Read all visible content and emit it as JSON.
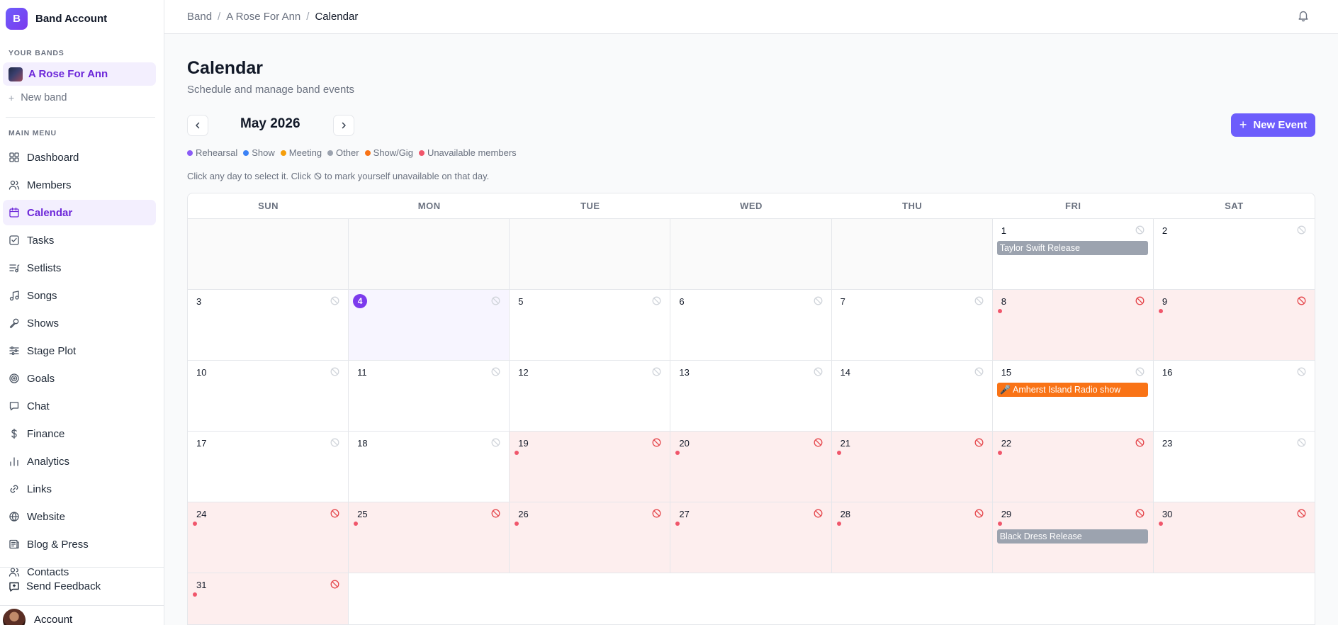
{
  "brand": {
    "initial": "B",
    "name": "Band Account"
  },
  "sidebar": {
    "bands_label": "YOUR BANDS",
    "current_band": "A Rose For Ann",
    "new_band": "New band",
    "menu_label": "MAIN MENU",
    "items": [
      {
        "label": "Dashboard",
        "icon": "dashboard-icon"
      },
      {
        "label": "Members",
        "icon": "users-icon"
      },
      {
        "label": "Calendar",
        "icon": "calendar-icon",
        "active": true
      },
      {
        "label": "Tasks",
        "icon": "checkbox-icon"
      },
      {
        "label": "Setlists",
        "icon": "list-music-icon"
      },
      {
        "label": "Songs",
        "icon": "music-note-icon"
      },
      {
        "label": "Shows",
        "icon": "microphone-icon"
      },
      {
        "label": "Stage Plot",
        "icon": "sliders-icon"
      },
      {
        "label": "Goals",
        "icon": "target-icon"
      },
      {
        "label": "Chat",
        "icon": "chat-icon"
      },
      {
        "label": "Finance",
        "icon": "dollar-icon"
      },
      {
        "label": "Analytics",
        "icon": "bar-chart-icon"
      },
      {
        "label": "Links",
        "icon": "link-icon"
      },
      {
        "label": "Website",
        "icon": "globe-icon"
      },
      {
        "label": "Blog & Press",
        "icon": "newspaper-icon"
      },
      {
        "label": "Contacts",
        "icon": "contacts-icon"
      }
    ],
    "feedback": "Send Feedback",
    "account": "Account"
  },
  "breadcrumb": [
    "Band",
    "A Rose For Ann",
    "Calendar"
  ],
  "page": {
    "title": "Calendar",
    "subtitle": "Schedule and manage band events",
    "month": "May 2026",
    "new_event": "New Event",
    "hint_before": "Click any day to select it. Click",
    "hint_after": "to mark yourself unavailable on that day."
  },
  "legend": [
    {
      "label": "Rehearsal",
      "color": "#8b5cf6"
    },
    {
      "label": "Show",
      "color": "#3b82f6"
    },
    {
      "label": "Meeting",
      "color": "#f59e0b"
    },
    {
      "label": "Other",
      "color": "#9ca3af"
    },
    {
      "label": "Show/Gig",
      "color": "#f97316"
    },
    {
      "label": "Unavailable members",
      "color": "#f0566b"
    }
  ],
  "weekdays": [
    "SUN",
    "MON",
    "TUE",
    "WED",
    "THU",
    "FRI",
    "SAT"
  ],
  "calendar": {
    "leading_empty": 5,
    "today": 4,
    "days": [
      {
        "d": "1",
        "events": [
          {
            "title": "Taylor Swift Release",
            "type": "other"
          }
        ]
      },
      {
        "d": "2"
      },
      {
        "d": "3"
      },
      {
        "d": "4"
      },
      {
        "d": "5"
      },
      {
        "d": "6"
      },
      {
        "d": "7"
      },
      {
        "d": "8",
        "unavailable": true
      },
      {
        "d": "9",
        "unavailable": true
      },
      {
        "d": "10"
      },
      {
        "d": "11"
      },
      {
        "d": "12"
      },
      {
        "d": "13"
      },
      {
        "d": "14"
      },
      {
        "d": "15",
        "events": [
          {
            "title": "🎤 Amherst Island Radio show",
            "type": "show"
          }
        ]
      },
      {
        "d": "16"
      },
      {
        "d": "17"
      },
      {
        "d": "18"
      },
      {
        "d": "19",
        "unavailable": true
      },
      {
        "d": "20",
        "unavailable": true
      },
      {
        "d": "21",
        "unavailable": true
      },
      {
        "d": "22",
        "unavailable": true
      },
      {
        "d": "23"
      },
      {
        "d": "24",
        "unavailable": true
      },
      {
        "d": "25",
        "unavailable": true
      },
      {
        "d": "26",
        "unavailable": true
      },
      {
        "d": "27",
        "unavailable": true
      },
      {
        "d": "28",
        "unavailable": true
      },
      {
        "d": "29",
        "unavailable": true,
        "events": [
          {
            "title": "Black Dress Release",
            "type": "other"
          }
        ]
      },
      {
        "d": "30",
        "unavailable": true
      },
      {
        "d": "31",
        "unavailable": true
      }
    ]
  }
}
